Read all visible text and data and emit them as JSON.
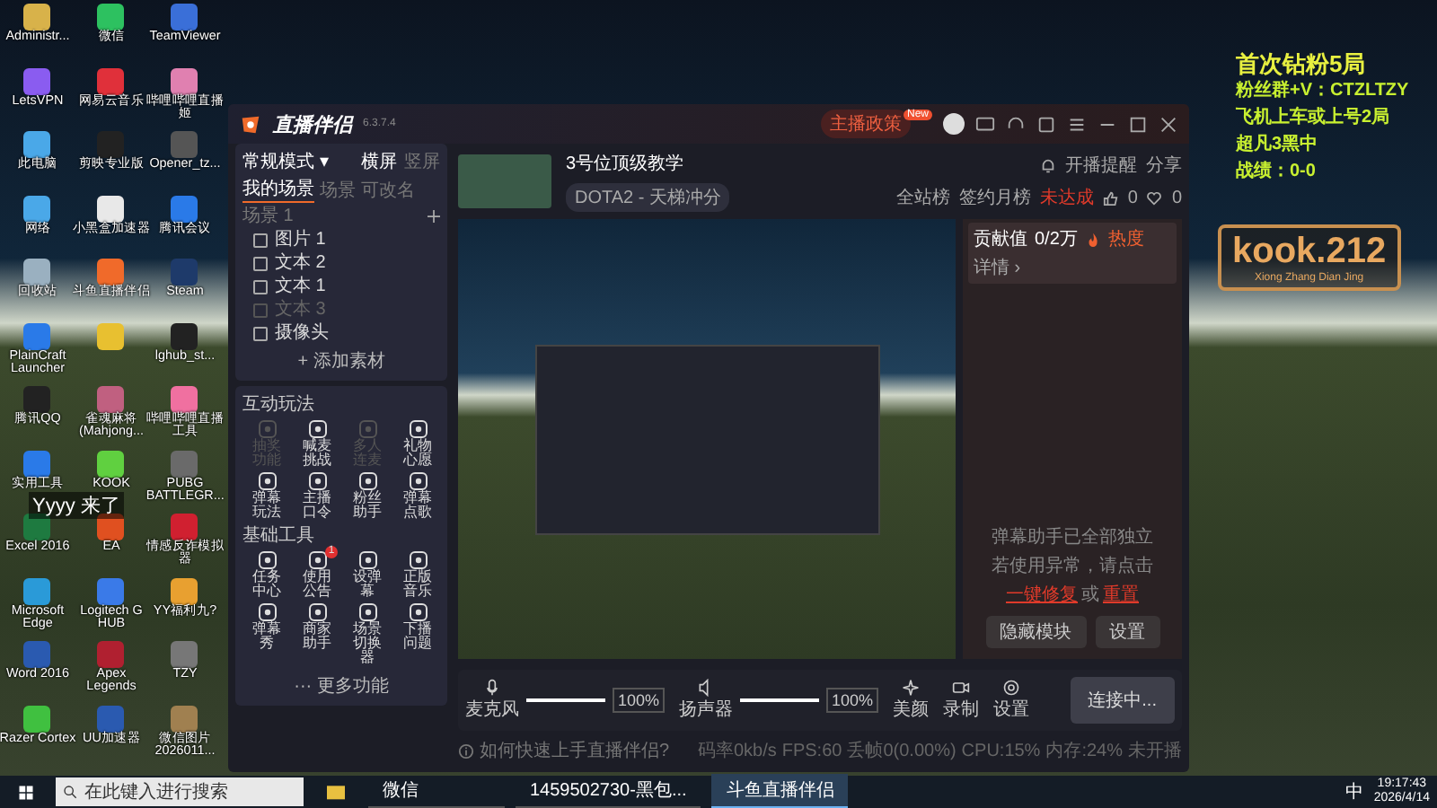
{
  "desktop_icons": [
    {
      "label": "Administr...",
      "color": "#d8b24a"
    },
    {
      "label": "微信",
      "color": "#2dc160"
    },
    {
      "label": "TeamViewer",
      "color": "#3a6fd8"
    },
    {
      "label": "LetsVPN",
      "color": "#8a5cf0"
    },
    {
      "label": "网易云音乐",
      "color": "#e0303a"
    },
    {
      "label": "哔哩哔哩直播姬",
      "color": "#e080b0"
    },
    {
      "label": "此电脑",
      "color": "#4aa8e8"
    },
    {
      "label": "剪映专业版",
      "color": "#222222"
    },
    {
      "label": "Opener_tz...",
      "color": "#555555"
    },
    {
      "label": "网络",
      "color": "#4aa8e8"
    },
    {
      "label": "小黑盒加速器",
      "color": "#e8e8e8"
    },
    {
      "label": "腾讯会议",
      "color": "#2a7ae8"
    },
    {
      "label": "回收站",
      "color": "#9ab0c0"
    },
    {
      "label": "斗鱼直播伴侣",
      "color": "#f06a2a"
    },
    {
      "label": "Steam",
      "color": "#1e3a6a"
    },
    {
      "label": "PlainCraft Launcher",
      "color": "#2a7ae8"
    },
    {
      "color": "#e8c030"
    },
    {
      "label": "lghub_st...",
      "color": "#222222"
    },
    {
      "label": "腾讯QQ",
      "color": "#222222"
    },
    {
      "label": "雀魂麻将 (Mahjong...",
      "color": "#c06080"
    },
    {
      "label": "哔哩哔哩直播工具",
      "color": "#f070a0"
    },
    {
      "label": "实用工具",
      "color": "#2a7ae8"
    },
    {
      "label": "KOOK",
      "color": "#60d040"
    },
    {
      "label": "PUBG BATTLEGR...",
      "color": "#6a6a6a"
    },
    {
      "label": "Excel 2016",
      "color": "#1e7a40"
    },
    {
      "label": "EA",
      "color": "#e05020"
    },
    {
      "label": "情感反诈模拟器",
      "color": "#d02030"
    },
    {
      "label": "Microsoft Edge",
      "color": "#2a9ad8"
    },
    {
      "label": "Logitech G HUB",
      "color": "#3a7ae8"
    },
    {
      "label": "YY福利九?",
      "color": "#e8a030"
    },
    {
      "label": "Word 2016",
      "color": "#2a5ab0"
    },
    {
      "label": "Apex Legends",
      "color": "#b02030"
    },
    {
      "label": "TZY",
      "color": "#777777"
    },
    {
      "label": "Razer Cortex",
      "color": "#40c040"
    },
    {
      "label": "UU加速器",
      "color": "#2a5ab0"
    },
    {
      "label": "微信图片 2026011...",
      "color": "#a08050"
    }
  ],
  "danmaku": "Yyyy 来了",
  "overlay": {
    "lines": [
      "首次钻粉5局",
      "粉丝群+V：CTZLTZY",
      "飞机上车或上号2局",
      "超凡3黑中",
      "战绩：0-0"
    ],
    "logo": "kook.212",
    "logo_sub": "Xiong Zhang Dian Jing"
  },
  "app": {
    "logo": "直播伴侣",
    "version": "6.3.7.4",
    "policy": "主播政策",
    "policy_badge": "New",
    "mode": "常规模式 ▾",
    "orientations": [
      {
        "label": "横屏",
        "selected": true
      },
      {
        "label": "竖屏",
        "selected": false
      }
    ],
    "scene_tabs": [
      {
        "label": "我的场景",
        "selected": true
      },
      {
        "label": "场景",
        "selected": false
      },
      {
        "label": "可改名",
        "selected": false
      },
      {
        "label": "场景 1",
        "selected": false
      }
    ],
    "sources": [
      {
        "label": "图片 1",
        "visible": true
      },
      {
        "label": "文本 2",
        "visible": true
      },
      {
        "label": "文本 1",
        "visible": true
      },
      {
        "label": "文本 3",
        "visible": false
      },
      {
        "label": "摄像头",
        "visible": true
      }
    ],
    "add_source": "+ 添加素材",
    "sections": [
      {
        "title": "互动玩法",
        "tools": [
          {
            "label": "抽奖功能",
            "disabled": true
          },
          {
            "label": "喊麦挑战",
            "disabled": false
          },
          {
            "label": "多人连麦",
            "disabled": true
          },
          {
            "label": "礼物心愿",
            "disabled": false
          },
          {
            "label": "弹幕玩法",
            "disabled": false
          },
          {
            "label": "主播口令",
            "disabled": false
          },
          {
            "label": "粉丝助手",
            "disabled": false
          },
          {
            "label": "弹幕点歌",
            "disabled": false
          }
        ]
      },
      {
        "title": "基础工具",
        "tools": [
          {
            "label": "任务中心",
            "disabled": false
          },
          {
            "label": "使用公告",
            "disabled": false,
            "badge": "1"
          },
          {
            "label": "设弹幕",
            "disabled": false
          },
          {
            "label": "正版音乐",
            "disabled": false
          },
          {
            "label": "弹幕秀",
            "disabled": false
          },
          {
            "label": "商家助手",
            "disabled": false
          },
          {
            "label": "场景切换器",
            "disabled": false
          },
          {
            "label": "下播问题",
            "disabled": false
          }
        ]
      }
    ],
    "more": "··· 更多功能",
    "stream": {
      "title": "3号位顶级教学",
      "category": "DOTA2 - 天梯冲分",
      "remind": "开播提醒",
      "share": "分享",
      "rank": "全站榜",
      "monthly": "签约月榜",
      "monthly_status": "未达成",
      "likes": "0",
      "hearts": "0"
    },
    "audio": [
      {
        "kind": "mic",
        "label": "麦克风",
        "level": 1,
        "reading": "100%"
      },
      {
        "kind": "speaker",
        "label": "扬声器",
        "level": 1,
        "reading": "100%"
      }
    ],
    "actions": [
      {
        "kind": "beauty",
        "label": "美颜"
      },
      {
        "kind": "record",
        "label": "录制"
      },
      {
        "kind": "settings",
        "label": "设置"
      }
    ],
    "go_live": "连接中...",
    "help": "如何快速上手直播伴侣?",
    "stats": [
      "码率0kb/s",
      "FPS:60",
      "丢帧0(0.00%)",
      "CPU:15%",
      "内存:24%",
      "未开播"
    ],
    "contribution": {
      "label": "贡献值",
      "value": "0/2万",
      "heat": "热度",
      "detail": "详情 ›"
    },
    "notice": {
      "line1": "弹幕助手已全部独立",
      "prefix": "若使用异常，请点击",
      "fix": "一键修复",
      "or": "或",
      "reset": "重置"
    },
    "panel_buttons": [
      "隐藏模块",
      "设置"
    ]
  },
  "taskbar": {
    "search": "在此键入进行搜索",
    "apps": [
      {
        "label": "微信",
        "selected": false
      },
      {
        "label": "1459502730-黑包...",
        "selected": false
      },
      {
        "label": "斗鱼直播伴侣",
        "selected": true
      }
    ],
    "ime": "中",
    "time": "19:17:43",
    "date": "2026/4/14"
  }
}
